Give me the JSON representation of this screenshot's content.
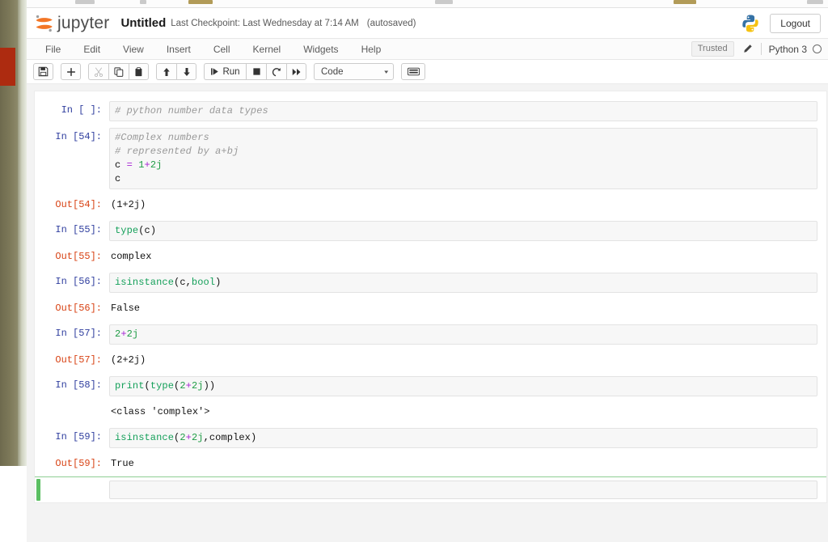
{
  "header": {
    "logo_icon": "jupyter-logo-icon",
    "wordmark": "jupyter",
    "notebook_name": "Untitled",
    "checkpoint": "Last Checkpoint: Last Wednesday at 7:14 AM",
    "autosaved": "(autosaved)",
    "python_logo_icon": "python-logo-icon",
    "logout_label": "Logout"
  },
  "menubar": {
    "items": [
      {
        "label": "File"
      },
      {
        "label": "Edit"
      },
      {
        "label": "View"
      },
      {
        "label": "Insert"
      },
      {
        "label": "Cell"
      },
      {
        "label": "Kernel"
      },
      {
        "label": "Widgets"
      },
      {
        "label": "Help"
      }
    ],
    "trusted_label": "Trusted",
    "pencil_icon": "pencil-icon",
    "kernel_label": "Python 3",
    "kernel_status_icon": "kernel-idle-circle-icon"
  },
  "toolbar": {
    "save_icon": "save-floppy-icon",
    "insert_icon": "plus-icon",
    "cut_icon": "scissors-icon",
    "copy_icon": "copy-icon",
    "paste_icon": "paste-icon",
    "move_up_icon": "arrow-up-icon",
    "move_down_icon": "arrow-down-icon",
    "run_icon": "run-play-icon",
    "run_label": "Run",
    "stop_icon": "stop-square-icon",
    "restart_icon": "restart-circle-icon",
    "restart_run_all_icon": "fast-forward-icon",
    "cell_type_value": "Code",
    "cell_type_caret_icon": "chevron-down-icon",
    "command_palette_icon": "keyboard-icon"
  },
  "notebook": {
    "cells": [
      {
        "type": "code",
        "prompt": "In [ ]:",
        "prompt_kind": "in",
        "lines": [
          [
            {
              "t": "# python number data types",
              "c": "cmt"
            }
          ]
        ]
      },
      {
        "type": "code",
        "prompt": "In [54]:",
        "prompt_kind": "in",
        "lines": [
          [
            {
              "t": "#Complex numbers",
              "c": "cmt"
            }
          ],
          [
            {
              "t": "# represented by a+bj",
              "c": "cmt"
            }
          ],
          [
            {
              "t": "c ",
              "c": "pl"
            },
            {
              "t": "=",
              "c": "op"
            },
            {
              "t": " ",
              "c": "pl"
            },
            {
              "t": "1",
              "c": "num"
            },
            {
              "t": "+",
              "c": "op"
            },
            {
              "t": "2j",
              "c": "num"
            }
          ],
          [
            {
              "t": "c",
              "c": "pl"
            }
          ],
          [
            {
              "t": "",
              "c": "pl"
            }
          ]
        ]
      },
      {
        "type": "output",
        "prompt": "Out[54]:",
        "prompt_kind": "out",
        "text": "(1+2j)"
      },
      {
        "type": "code",
        "prompt": "In [55]:",
        "prompt_kind": "in",
        "lines": [
          [
            {
              "t": "type",
              "c": "fn"
            },
            {
              "t": "(c)",
              "c": "pl"
            }
          ]
        ]
      },
      {
        "type": "output",
        "prompt": "Out[55]:",
        "prompt_kind": "out",
        "text": "complex"
      },
      {
        "type": "code",
        "prompt": "In [56]:",
        "prompt_kind": "in",
        "lines": [
          [
            {
              "t": "isinstance",
              "c": "fn"
            },
            {
              "t": "(c,",
              "c": "pl"
            },
            {
              "t": "bool",
              "c": "kw"
            },
            {
              "t": ")",
              "c": "pl"
            }
          ]
        ]
      },
      {
        "type": "output",
        "prompt": "Out[56]:",
        "prompt_kind": "out",
        "text": "False"
      },
      {
        "type": "code",
        "prompt": "In [57]:",
        "prompt_kind": "in",
        "lines": [
          [
            {
              "t": "2",
              "c": "num"
            },
            {
              "t": "+",
              "c": "op"
            },
            {
              "t": "2j",
              "c": "num"
            }
          ]
        ]
      },
      {
        "type": "output",
        "prompt": "Out[57]:",
        "prompt_kind": "out",
        "text": "(2+2j)"
      },
      {
        "type": "code",
        "prompt": "In [58]:",
        "prompt_kind": "in",
        "lines": [
          [
            {
              "t": "print",
              "c": "fn"
            },
            {
              "t": "(",
              "c": "pl"
            },
            {
              "t": "type",
              "c": "fn"
            },
            {
              "t": "(",
              "c": "pl"
            },
            {
              "t": "2",
              "c": "num"
            },
            {
              "t": "+",
              "c": "op"
            },
            {
              "t": "2j",
              "c": "num"
            },
            {
              "t": "))",
              "c": "pl"
            }
          ]
        ]
      },
      {
        "type": "stream",
        "prompt": "",
        "prompt_kind": "empty",
        "text": "<class 'complex'>"
      },
      {
        "type": "code",
        "prompt": "In [59]:",
        "prompt_kind": "in",
        "lines": [
          [
            {
              "t": "isinstance",
              "c": "fn"
            },
            {
              "t": "(",
              "c": "pl"
            },
            {
              "t": "2",
              "c": "num"
            },
            {
              "t": "+",
              "c": "op"
            },
            {
              "t": "2j",
              "c": "num"
            },
            {
              "t": ",complex)",
              "c": "pl"
            }
          ]
        ]
      },
      {
        "type": "output",
        "prompt": "Out[59]:",
        "prompt_kind": "out",
        "text": "True"
      },
      {
        "type": "code",
        "prompt": "",
        "prompt_kind": "empty",
        "selected": true,
        "lines": [
          [
            {
              "t": "",
              "c": "pl"
            }
          ]
        ]
      }
    ]
  },
  "colors": {
    "jupyter_orange": "#f37626",
    "prompt_in": "#303f9f",
    "prompt_out": "#d84315",
    "selected_cell_green": "#5bbf62",
    "syntax_comment": "#999999",
    "syntax_number": "#1f9c46",
    "syntax_operator": "#a626d4",
    "syntax_builtin": "#15a05a"
  }
}
